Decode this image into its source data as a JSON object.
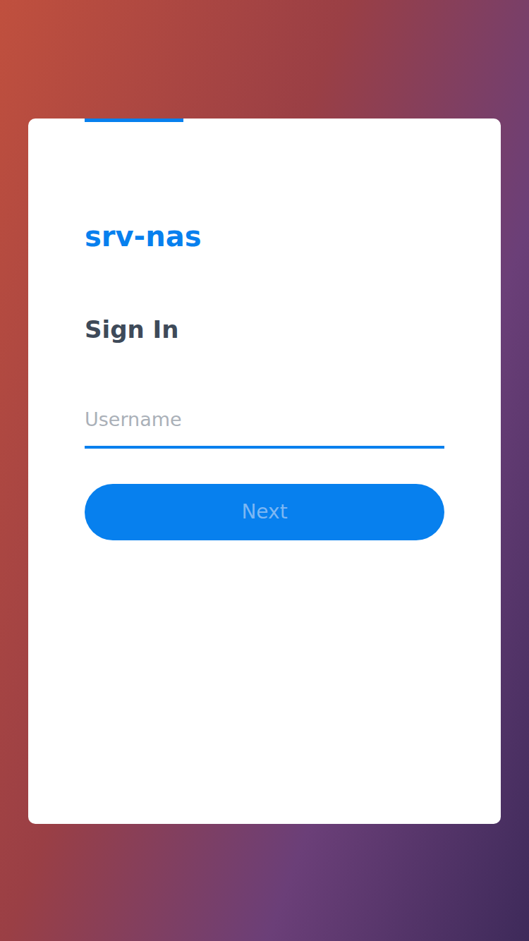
{
  "login": {
    "server_name": "srv-nas",
    "heading": "Sign In",
    "username_field": {
      "placeholder": "Username",
      "value": "",
      "focused": true
    },
    "next_button": {
      "label": "Next",
      "disabled": true
    }
  }
}
